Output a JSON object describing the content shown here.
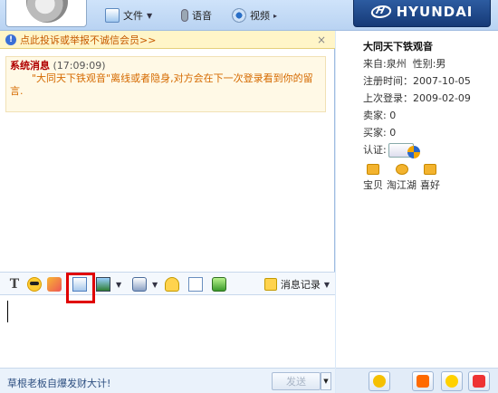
{
  "toolbar": {
    "file_label": "文件",
    "voice_label": "语音",
    "video_label": "视频"
  },
  "brand": {
    "text": "HYUNDAI"
  },
  "notice": {
    "text": "点此投诉或举报不诚信会员>>",
    "close": "×"
  },
  "system_message": {
    "title": "系统消息",
    "time": "(17:09:09)",
    "body": "\"大同天下铁观音\"离线或者隐身,对方会在下一次登录看到你的留言."
  },
  "chat_toolbar": {
    "history_label": "消息记录"
  },
  "input": {
    "value": ""
  },
  "footer": {
    "promo": "草根老板自爆发财大计!",
    "send_label": "发送"
  },
  "profile": {
    "name": "大同天下铁观音",
    "origin": "来自:泉州",
    "gender": "性别:男",
    "registered": "注册时间：2007-10-05",
    "last_login": "上次登录：2009-02-09",
    "seller": "卖家: 0",
    "buyer": "买家: 0",
    "cert_label": "认证:",
    "shortcuts": [
      "宝贝",
      "淘江湖",
      "喜好"
    ]
  }
}
